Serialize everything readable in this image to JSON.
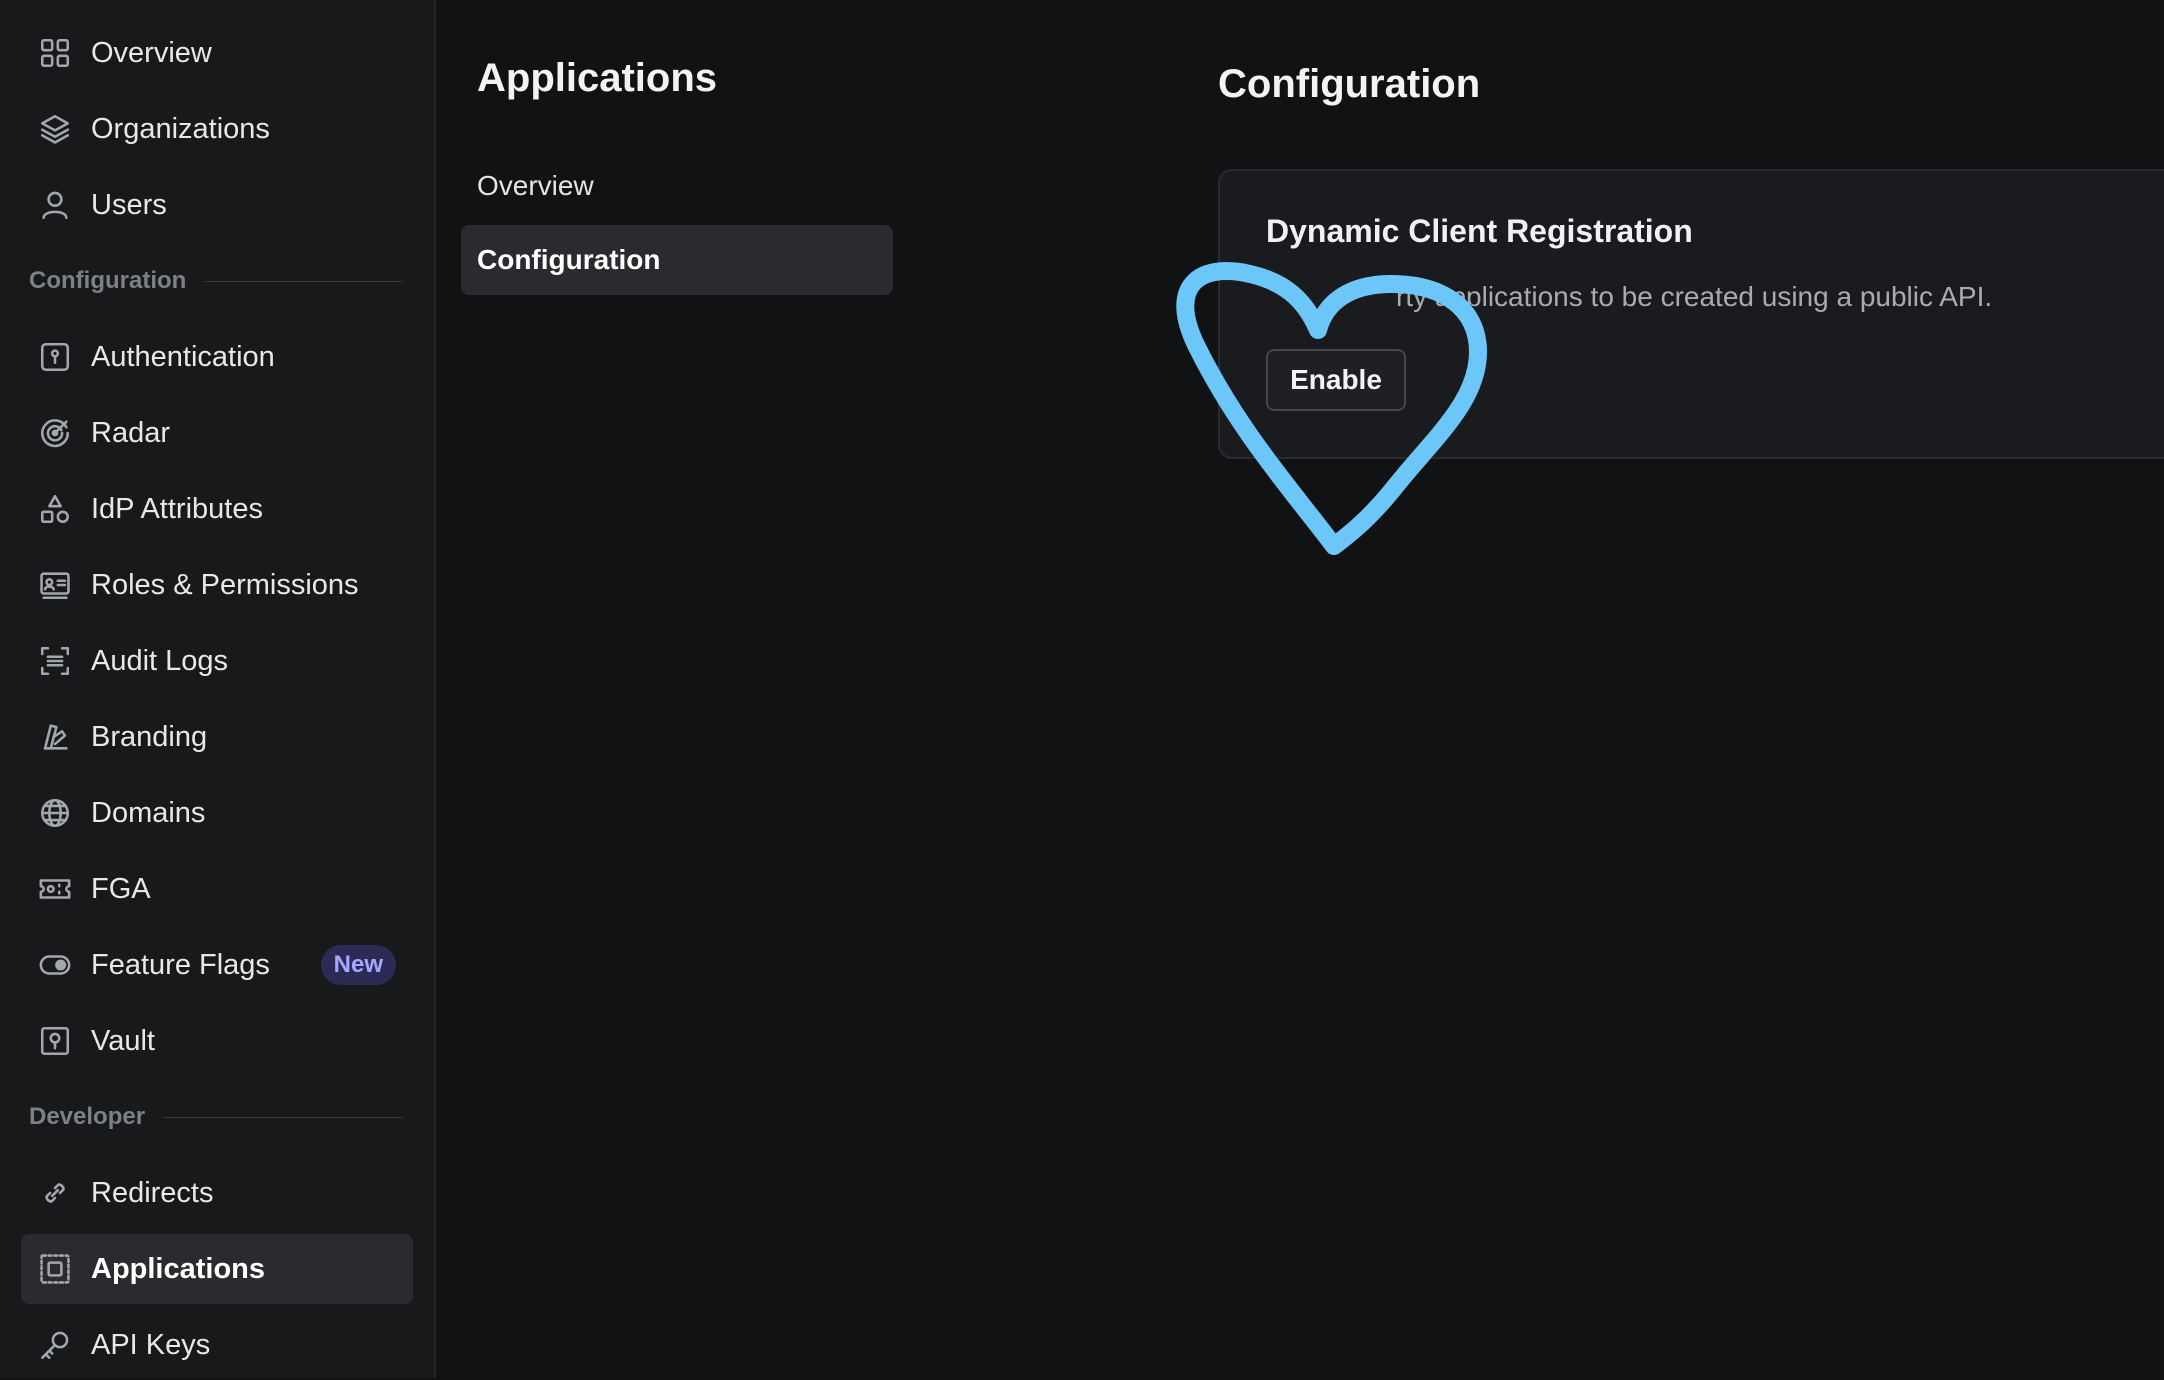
{
  "sidebar": {
    "items_top": [
      {
        "label": "Overview",
        "icon": "grid-icon"
      },
      {
        "label": "Organizations",
        "icon": "layers-icon"
      },
      {
        "label": "Users",
        "icon": "user-icon"
      }
    ],
    "section_configuration": "Configuration",
    "items_config": [
      {
        "label": "Authentication",
        "icon": "keyhole-icon"
      },
      {
        "label": "Radar",
        "icon": "radar-icon"
      },
      {
        "label": "IdP Attributes",
        "icon": "shapes-icon"
      },
      {
        "label": "Roles & Permissions",
        "icon": "id-card-icon"
      },
      {
        "label": "Audit Logs",
        "icon": "scan-list-icon"
      },
      {
        "label": "Branding",
        "icon": "swatch-icon"
      },
      {
        "label": "Domains",
        "icon": "globe-icon"
      },
      {
        "label": "FGA",
        "icon": "ticket-icon"
      },
      {
        "label": "Feature Flags",
        "icon": "toggle-icon",
        "badge": "New"
      },
      {
        "label": "Vault",
        "icon": "vault-icon"
      }
    ],
    "section_developer": "Developer",
    "items_dev": [
      {
        "label": "Redirects",
        "icon": "link-icon"
      },
      {
        "label": "Applications",
        "icon": "app-frame-icon",
        "active": true
      },
      {
        "label": "API Keys",
        "icon": "key-icon"
      }
    ]
  },
  "subnav": {
    "title": "Applications",
    "items": [
      {
        "label": "Overview"
      },
      {
        "label": "Configuration",
        "active": true
      }
    ]
  },
  "main": {
    "title": "Configuration",
    "card": {
      "title": "Dynamic Client Registration",
      "description": "rty applications to be created using a public API.",
      "button": "Enable"
    }
  },
  "annotation": {
    "shape": "heart",
    "color": "#6cc6f7"
  },
  "colors": {
    "background": "#111214",
    "sidebar": "#18191b",
    "active": "#2a2b2f",
    "badge_bg": "#2c2b55",
    "badge_text": "#a8a6ff"
  }
}
